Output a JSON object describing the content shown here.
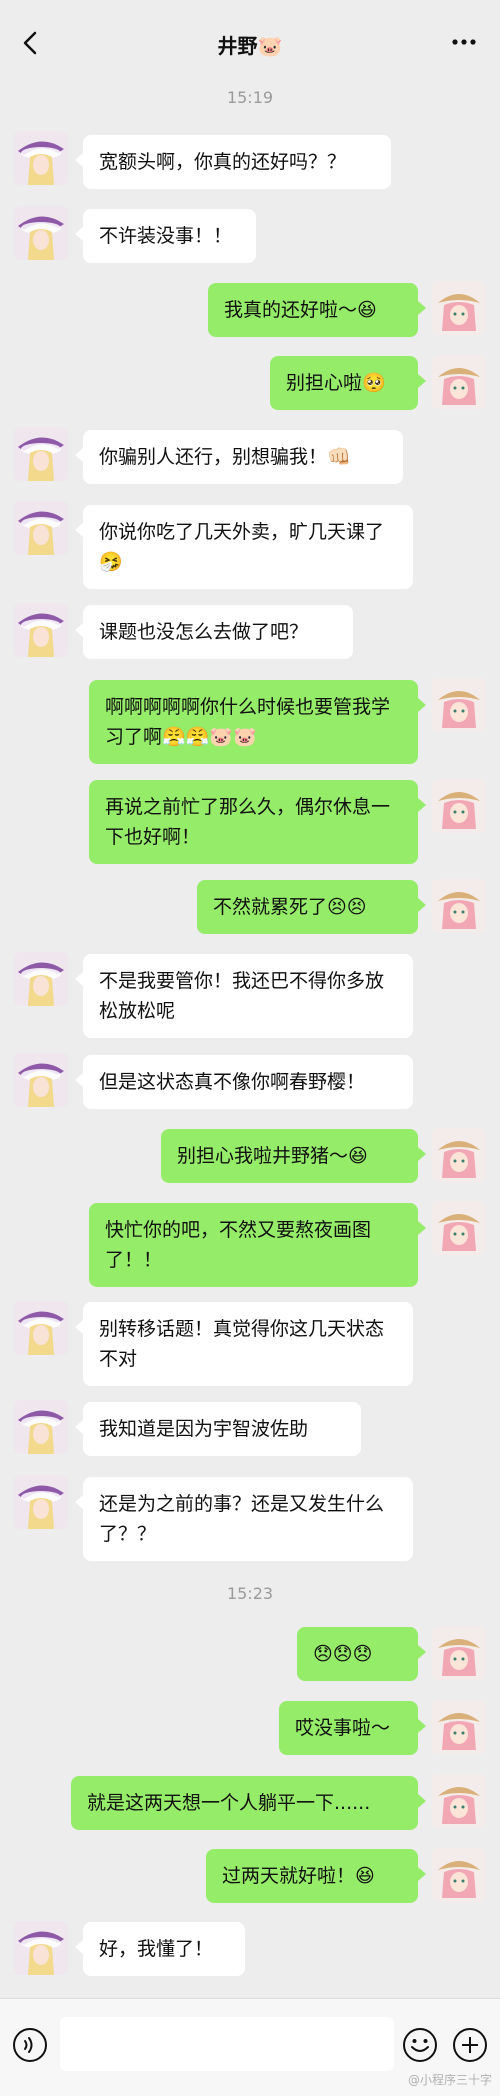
{
  "header": {
    "title": "井野🐷",
    "back_icon": "chevron-left-icon",
    "more_icon": "more-dots-icon"
  },
  "colors": {
    "background": "#ededed",
    "incoming_bubble": "#ffffff",
    "outgoing_bubble": "#95ec69"
  },
  "timestamps": [
    "15:19",
    "15:23"
  ],
  "messages": [
    {
      "side": "in",
      "text": "宽额头啊，你真的还好吗？？"
    },
    {
      "side": "in",
      "text": "不许装没事！！"
    },
    {
      "side": "out",
      "text": "我真的还好啦～😆"
    },
    {
      "side": "out",
      "text": "别担心啦🥺"
    },
    {
      "side": "in",
      "text": "你骗别人还行，别想骗我！👊🏻"
    },
    {
      "side": "in",
      "text": "你说你吃了几天外卖，旷几天课了🤧"
    },
    {
      "side": "in",
      "text": "课题也没怎么去做了吧？"
    },
    {
      "side": "out",
      "text": "啊啊啊啊啊你什么时候也要管我学习了啊😤😤🐷🐷"
    },
    {
      "side": "out",
      "text": "再说之前忙了那么久，偶尔休息一下也好啊！"
    },
    {
      "side": "out",
      "text": "不然就累死了😣😣"
    },
    {
      "side": "in",
      "text": "不是我要管你！我还巴不得你多放松放松呢"
    },
    {
      "side": "in",
      "text": "但是这状态真不像你啊春野樱！"
    },
    {
      "side": "out",
      "text": "别担心我啦井野猪～😆"
    },
    {
      "side": "out",
      "text": "快忙你的吧，不然又要熬夜画图了！！"
    },
    {
      "side": "in",
      "text": "别转移话题！真觉得你这几天状态不对"
    },
    {
      "side": "in",
      "text": "我知道是因为宇智波佐助"
    },
    {
      "side": "in",
      "text": "还是为之前的事？还是又发生什么了？？"
    },
    {
      "side": "out",
      "text": "😞😞😞"
    },
    {
      "side": "out",
      "text": "哎没事啦～"
    },
    {
      "side": "out",
      "text": "就是这两天想一个人躺平一下......"
    },
    {
      "side": "out",
      "text": "过两天就好啦！😆"
    },
    {
      "side": "in",
      "text": "好，我懂了！"
    }
  ],
  "composer": {
    "voice_icon": "voice-icon",
    "emoji_icon": "emoji-icon",
    "plus_icon": "plus-icon",
    "input_value": ""
  },
  "watermark": "@小程序三十字"
}
